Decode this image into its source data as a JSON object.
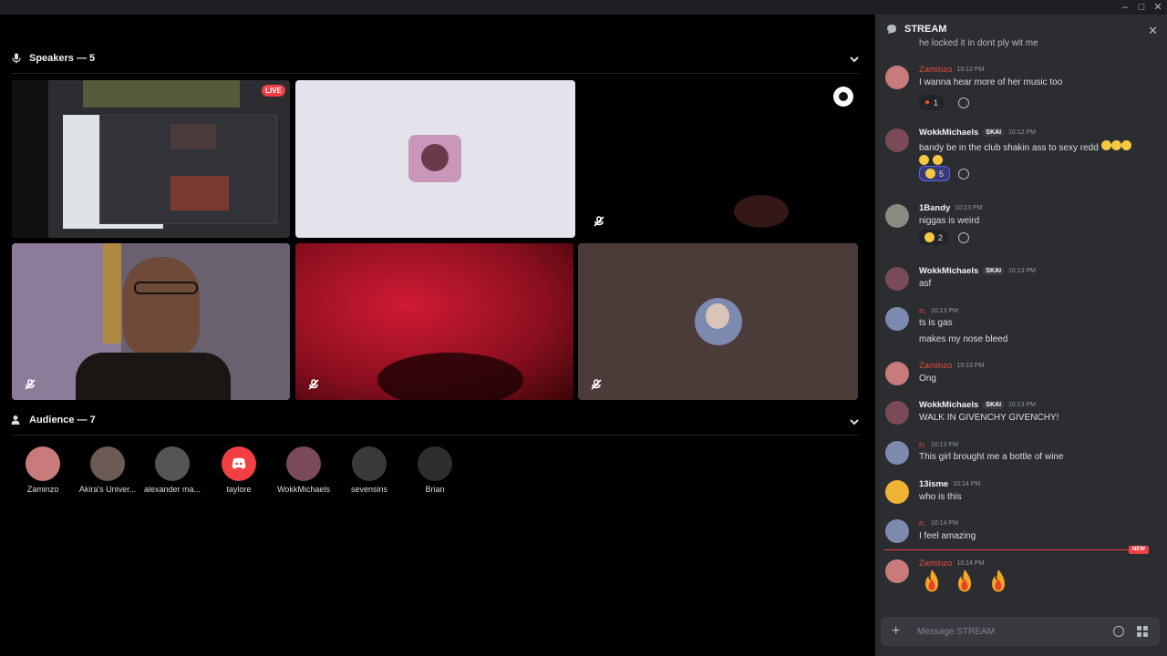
{
  "window": {
    "minimize": "–",
    "maximize": "□",
    "close": "✕"
  },
  "speakers": {
    "label": "Speakers — 5"
  },
  "audience": {
    "label": "Audience — 7",
    "members": [
      {
        "name": "Zaminzo",
        "color": "#c97a7a"
      },
      {
        "name": "Akira's Univer...",
        "color": "#6b5a55"
      },
      {
        "name": "alexander ma...",
        "color": "#555555"
      },
      {
        "name": "taylore",
        "color": "#f23f43"
      },
      {
        "name": "WokkMichaels",
        "color": "#7a4a58"
      },
      {
        "name": "sevensins",
        "color": "#3a3a3a"
      },
      {
        "name": "Brian",
        "color": "#2e2e2e"
      }
    ]
  },
  "stream_tiles": {
    "live_badge": "LIVE"
  },
  "chat": {
    "title": "STREAM",
    "close": "✕",
    "cutoff_text": "he locked it in dont ply wit me",
    "messages": [
      {
        "author": "Zaminzo",
        "time": "10:12 PM",
        "lines": [
          "I wanna hear more of her music too"
        ],
        "reaction_count": "1"
      },
      {
        "author": "WokkMichaels",
        "tag": "SKAI",
        "time": "10:12 PM",
        "lines": [
          "bandy be in the club shakin ass to sexy redd"
        ],
        "reaction_count": "5"
      },
      {
        "author": "1Bandy",
        "time": "10:13 PM",
        "lines": [
          "niggas is weird"
        ],
        "reaction_count": "2"
      },
      {
        "author": "WokkMichaels",
        "tag": "SKAI",
        "time": "10:13 PM",
        "lines": [
          "asf"
        ]
      },
      {
        "author": "n.",
        "time": "10:13 PM",
        "lines": [
          "ts is gas",
          "makes my nose bleed"
        ]
      },
      {
        "author": "Zaminzo",
        "time": "10:13 PM",
        "lines": [
          "Ong"
        ]
      },
      {
        "author": "WokkMichaels",
        "tag": "SKAI",
        "time": "10:13 PM",
        "lines": [
          "WALK IN GIVENCHY GIVENCHY!"
        ]
      },
      {
        "author": "n.",
        "time": "10:13 PM",
        "lines": [
          "This girl brought me a bottle of wine"
        ]
      },
      {
        "author": "13isme",
        "time": "10:14 PM",
        "lines": [
          "who is this"
        ]
      },
      {
        "author": "n.",
        "time": "10:14 PM",
        "lines": [
          "I feel amazing"
        ]
      },
      {
        "author": "Zaminzo",
        "time": "10:14 PM",
        "lines": []
      }
    ],
    "new_badge": "NEW",
    "composer_placeholder": "Message STREAM"
  }
}
